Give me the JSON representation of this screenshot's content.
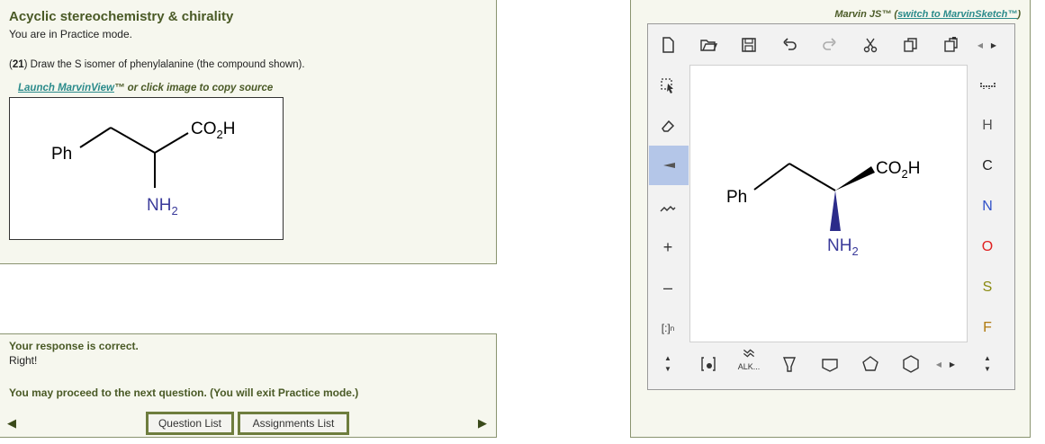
{
  "question": {
    "title": "Acyclic stereochemistry & chirality",
    "mode": "You are in Practice mode.",
    "number": "21",
    "text": "Draw the S isomer of phenylalanine (the compound shown).",
    "launch_link": "Launch MarvinView",
    "launch_rest": "™ or click image to copy source"
  },
  "molecule": {
    "ph": "Ph",
    "co2h_main": "CO",
    "co2h_sub": "2",
    "co2h_end": "H",
    "nh2_main": "NH",
    "nh2_sub": "2"
  },
  "response": {
    "correct": "Your response is correct.",
    "right": "Right!",
    "proceed": "You may proceed to the next question. (You will exit Practice mode.)",
    "question_list": "Question List",
    "assignments_list": "Assignments List"
  },
  "marvin": {
    "title_prefix": "Marvin JS™ (",
    "switch_link": "switch to MarvinSketch™",
    "title_suffix": ")",
    "elements": [
      "H",
      "C",
      "N",
      "O",
      "S",
      "F"
    ],
    "element_colors": {
      "H": "#555555",
      "C": "#222222",
      "N": "#3050c8",
      "O": "#e02020",
      "S": "#8a8a10",
      "F": "#b07a10"
    },
    "alk_label": "ALK..."
  },
  "colors": {
    "panel_bg": "#f6f7ee",
    "accent": "#4a5a26",
    "link": "#2b8b8b",
    "nitrogen": "#3a3a9a",
    "selected": "#b4c6e8"
  }
}
